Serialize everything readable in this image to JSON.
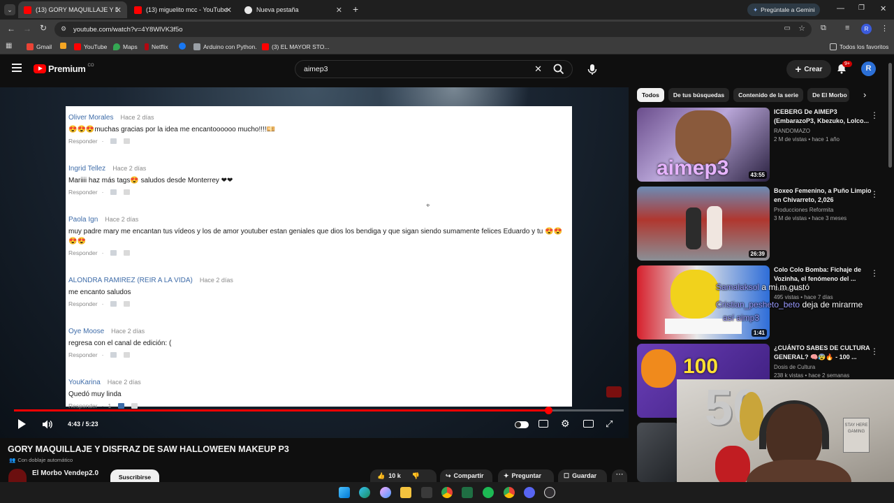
{
  "browser": {
    "tabs": [
      {
        "label": "(13) GORY MAQUILLAJE Y DISFR",
        "active": true
      },
      {
        "label": "(13) miguelito mcc - YouTube",
        "active": false
      },
      {
        "label": "Nueva pestaña",
        "active": false
      }
    ],
    "gemini_label": "Pregúntale a Gemini",
    "url": "youtube.com/watch?v=4Y8WlVK3f5o",
    "bookmarks": [
      "Gmail",
      "YouTube",
      "Maps",
      "Netflix",
      "Arduino con Python.",
      "(3) EL MAYOR STO..."
    ],
    "all_bookmarks_label": "Todos los favoritos",
    "profile_initial": "R"
  },
  "youtube": {
    "logo_text": "Premium",
    "logo_region": "CO",
    "search_value": "aimep3",
    "create_label": "Crear",
    "notif_count": "9+",
    "avatar_initial": "R"
  },
  "video_frame": {
    "comments": [
      {
        "author": "Oliver Morales",
        "date": "Hace 2 días",
        "text": "😍😍😍muchas gracias por la idea me encantoooooo   mucho!!!!💴",
        "reply": "Responder",
        "likes": ""
      },
      {
        "author": "Ingrid Tellez",
        "date": "Hace 2 días",
        "text": "Mariiii haz más tags😍 saludos desde Monterrey ❤❤",
        "reply": "Responder",
        "likes": ""
      },
      {
        "author": "Paola Ign",
        "date": "Hace 2 días",
        "text": "muy padre mary me encantan tus vídeos y los de amor youtuber estan geniales que dios los bendiga y que sigan siendo sumamente felices Eduardo y tu 😍😍😍😍",
        "reply": "Responder",
        "likes": ""
      },
      {
        "author": "ALONDRA RAMIREZ (REIR A LA VIDA)",
        "date": "Hace 2 días",
        "text": "me encanto saludos",
        "reply": "Responder",
        "likes": ""
      },
      {
        "author": "Oye Moose",
        "date": "Hace 2 días",
        "text": "regresa con el canal de edición: (",
        "reply": "Responder",
        "likes": ""
      },
      {
        "author": "YouKarina",
        "date": "Hace 2 días",
        "text": "Quedó muy linda",
        "reply": "Responder",
        "likes": "1"
      }
    ]
  },
  "player": {
    "time": "4:43 / 5:23",
    "progress": 0.876
  },
  "video_info": {
    "title": "GORY MAQUILLAJE Y DISFRAZ DE SAW HALLOWEEN MAKEUP P3",
    "dub_label": "Con doblaje automático",
    "channel": "El Morbo Vendep2.0",
    "subscribe_label": "Suscribirse",
    "likes": "10 k",
    "share_label": "Compartir",
    "ask_label": "Preguntar",
    "save_label": "Guardar"
  },
  "sidebar": {
    "chips": [
      "Todos",
      "De tus búsquedas",
      "Contenido de la serie",
      "De El Morbo"
    ],
    "recs": [
      {
        "title": "ICEBERG De AIMEP3 (EmbarazoP3, Kbezuko, Lolco...",
        "channel": "RANDOMAZO",
        "meta": "2 M de vistas • hace 1 año",
        "duration": "43:55",
        "thumb_text": "aimep3"
      },
      {
        "title": "Boxeo Femenino, a Puño Limpio en Chivarreto,  2,026",
        "channel": "Producciones Reformita",
        "meta": "3 M de vistas • hace 3 meses",
        "duration": "26:39"
      },
      {
        "title": "Colo Colo Bomba: Fichaje de Vozinha, el fenómeno del ...",
        "channel": "Cuarta Hora",
        "meta": "495 vistas • hace 7 días",
        "duration": "1:41"
      },
      {
        "title": "¿CUÁNTO SABES DE CULTURA GENERAL? 🧠😰🔥 - 100 ...",
        "channel": "Dosis de Cultura",
        "meta": "238 k vistas • hace 2 semanas",
        "duration": "",
        "thumb_text": "100"
      }
    ]
  },
  "stream_overlay": {
    "line1_user": "Samalaksol",
    "line1_msg": "a mi m gustó",
    "line2_user": "Cristian_pesheto_beto",
    "line2_msg": "deja de mirarme",
    "line3": "así aimp3"
  },
  "webcam": {
    "balloon_text": "50",
    "sign_text": "STAY HERE GAMING"
  }
}
